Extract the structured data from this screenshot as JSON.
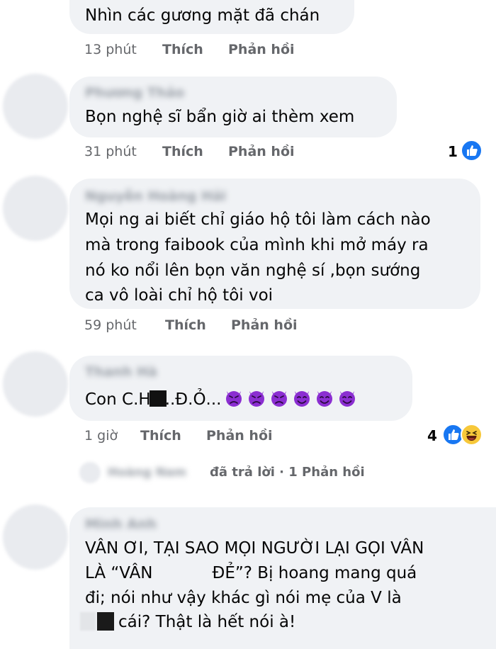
{
  "comments": [
    {
      "text": "Nhìn các gương mặt đã chán",
      "time": "13 phút",
      "like_label": "Thích",
      "reply_label": "Phản hồi"
    },
    {
      "author": "Phương Thảo",
      "text": "Bọn nghệ sĩ bẩn giờ ai thèm xem",
      "time": "31 phút",
      "like_label": "Thích",
      "reply_label": "Phản hồi",
      "reaction_count": "1",
      "reactions": [
        "like-icon"
      ]
    },
    {
      "author": "Nguyễn Hoàng Hải",
      "lines": [
        "Mọi ng ai biết chỉ giáo hộ tôi làm cách nào",
        "mà trong faibook của mình khi mở máy ra",
        "nó ko nổi lên bọn văn nghệ sí ,bọn sướng",
        "ca vô loài chỉ hộ tôi voi"
      ],
      "time": "59 phút",
      "like_label": "Thích",
      "reply_label": "Phản hồi"
    },
    {
      "author": "Thanh Hà",
      "text_before": "Con C.H",
      "text_after": "..Đ.Ỏ...",
      "emoji": [
        "angry-devil-icon",
        "angry-devil-icon",
        "angry-devil-icon",
        "smiling-devil-icon",
        "smiling-devil-icon",
        "smiling-devil-icon"
      ],
      "time": "1 giờ",
      "like_label": "Thích",
      "reply_label": "Phản hồi",
      "reaction_count": "4",
      "reactions": [
        "like-icon",
        "haha-icon"
      ]
    },
    {
      "author": "Hoàng Nam",
      "replied_text": "đã trả lời · 1 Phản hồi"
    },
    {
      "author": "Minh Anh",
      "line1": "VÂN ƠI, TẠI SAO MỌI NGƯỜI LẠI GỌI VÂN",
      "line2_before": "LÀ “VÂN",
      "line2_after": "ĐẺ”? Bị hoang mang quá",
      "line3": "đi; nói như vậy khác gì nói mẹ của V là",
      "line4": "cái? Thật là hết nói à!"
    }
  ],
  "colors": {
    "bubble": "#f0f2f5",
    "meta": "#65676b",
    "text": "#050505",
    "like": "#1877f2",
    "devil": "#8b2ed1"
  }
}
